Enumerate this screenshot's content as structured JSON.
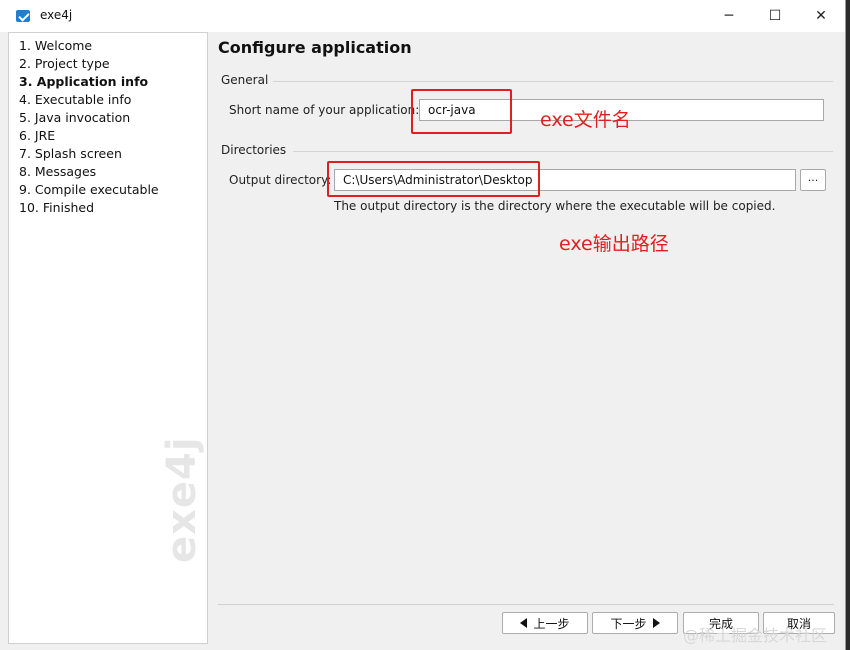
{
  "window": {
    "title": "exe4j",
    "minimize_glyph": "─",
    "maximize_glyph": "☐",
    "close_glyph": "✕"
  },
  "sidebar": {
    "steps": [
      "1. Welcome",
      "2. Project type",
      "3. Application info",
      "4. Executable info",
      "5. Java invocation",
      "6. JRE",
      "7. Splash screen",
      "8. Messages",
      "9. Compile executable",
      "10. Finished"
    ],
    "active_index": 2,
    "watermark": "exe4j"
  },
  "main": {
    "title": "Configure application",
    "general": {
      "label": "General",
      "short_name_label": "Short name of your application:",
      "short_name_value": "ocr-java"
    },
    "directories": {
      "label": "Directories",
      "output_label": "Output directory:",
      "output_value": "C:\\Users\\Administrator\\Desktop",
      "browse_label": "...",
      "hint": "The output directory is the directory where the executable will be copied."
    }
  },
  "annotations": {
    "name": "exe文件名",
    "path": "exe输出路径"
  },
  "buttons": {
    "back": "上一步",
    "next": "下一步",
    "finish": "完成",
    "cancel": "取消"
  },
  "overlay_watermark": "@稀土掘金技术社区",
  "colors": {
    "annotation_red": "#e02020",
    "accent_blue": "#1e7fd1"
  }
}
